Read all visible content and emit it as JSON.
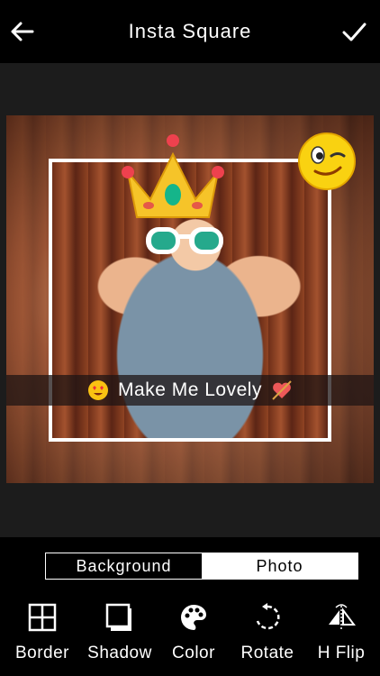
{
  "header": {
    "title": "Insta Square",
    "back_icon": "arrow-left-icon",
    "confirm_icon": "check-icon"
  },
  "editor": {
    "caption": "Make Me Lovely",
    "stickers": [
      "crown-sticker",
      "sunglasses-sticker",
      "wink-emoji-sticker"
    ],
    "caption_emojis": [
      "heart-eyes-emoji",
      "arrow-heart-emoji"
    ]
  },
  "mode_toggle": {
    "options": [
      {
        "label": "Background",
        "selected": false
      },
      {
        "label": "Photo",
        "selected": true
      }
    ]
  },
  "tools": [
    {
      "label": "Border",
      "icon": "grid-icon"
    },
    {
      "label": "Shadow",
      "icon": "shadow-square-icon"
    },
    {
      "label": "Color",
      "icon": "palette-icon"
    },
    {
      "label": "Rotate",
      "icon": "rotate-icon"
    },
    {
      "label": "H Flip",
      "icon": "horizontal-flip-icon"
    }
  ],
  "colors": {
    "bar": "#000000",
    "workspace": "#1c1c1c",
    "accent": "#ffffff"
  }
}
